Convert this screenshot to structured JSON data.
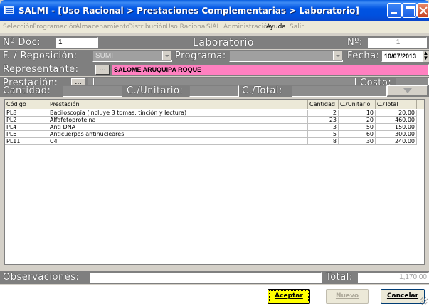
{
  "window": {
    "title": "SALMI - [Uso Racional > Prestaciones Complementarias > Laboratorio]"
  },
  "menu": [
    {
      "label": "Selección",
      "enabled": false
    },
    {
      "label": "Programación",
      "enabled": false
    },
    {
      "label": "Almacenamiento",
      "enabled": false
    },
    {
      "label": "Distribución",
      "enabled": false
    },
    {
      "label": "Uso Racional",
      "enabled": false
    },
    {
      "label": "SIAL",
      "enabled": false
    },
    {
      "label": "Administración",
      "enabled": false
    },
    {
      "label": "Ayuda",
      "enabled": true
    },
    {
      "label": "Salir",
      "enabled": false
    }
  ],
  "header": {
    "doc_label": "Nº Doc:",
    "doc_value": "1",
    "form_title": "Laboratorio",
    "number_label": "Nº:",
    "number_value": "1"
  },
  "reposicion": {
    "label": "F. / Reposición:",
    "value": "SUMI",
    "programa_label": "Programa:",
    "programa_value": "",
    "fecha_label": "Fecha:",
    "fecha_value": "10/07/2013"
  },
  "representante": {
    "label": "Representante:",
    "button": "...",
    "value": "SALOME ARUQUIPA ROQUE"
  },
  "prestacion": {
    "label": "Prestación:",
    "button": "...",
    "code_value": "",
    "value": "",
    "costo_label": "Costo:",
    "costo_value": ""
  },
  "cantidad_row": {
    "cantidad_label": "Cantidad:",
    "cantidad_value": "",
    "unitario_label": "C./Unitario:",
    "unitario_value": "",
    "total_label": "C./Total:",
    "total_value": ""
  },
  "grid": {
    "columns": [
      "Código",
      "Prestación",
      "Cantidad",
      "C./Unitario",
      "C./Total"
    ],
    "rows": [
      [
        "PL8",
        "Baciloscopía (incluye 3 tomas, tinción y lectura)",
        "2",
        "10",
        "20.00"
      ],
      [
        "PL2",
        "Alfafetoproteina",
        "23",
        "20",
        "460.00"
      ],
      [
        "PL4",
        "Anti DNA",
        "3",
        "50",
        "150.00"
      ],
      [
        "PL6",
        "Anticuerpos antinucleares",
        "5",
        "60",
        "300.00"
      ],
      [
        "PL11",
        "C4",
        "8",
        "30",
        "240.00"
      ]
    ]
  },
  "bottom": {
    "observaciones_label": "Observaciones:",
    "observaciones_value": "",
    "total_label": "Total:",
    "total_value": "1,170.00"
  },
  "buttons": {
    "accept": "Aceptar",
    "new": "Nuevo",
    "cancel": "Cancelar"
  },
  "colors": {
    "representante_bg": "#ff80c0",
    "row_bg": "#7f7f7f",
    "accept_bg": "#ffff00"
  }
}
